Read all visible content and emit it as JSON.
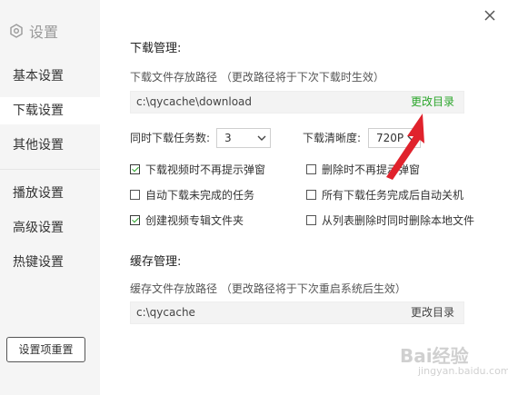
{
  "sidebar": {
    "title": "设置",
    "items": [
      {
        "label": "基本设置"
      },
      {
        "label": "下载设置"
      },
      {
        "label": "其他设置"
      },
      {
        "label": "播放设置"
      },
      {
        "label": "高级设置"
      },
      {
        "label": "热键设置"
      }
    ],
    "reset_label": "设置项重置"
  },
  "download": {
    "heading": "下载管理:",
    "path_hint": "下载文件存放路径 （更改路径将于下次下载时生效）",
    "path_value": "c:\\qycache\\download",
    "change_label": "更改目录",
    "tasks_label": "同时下载任务数:",
    "tasks_value": "3",
    "quality_label": "下载清晰度:",
    "quality_value": "720P",
    "options": [
      {
        "label": "下载视频时不再提示弹窗",
        "checked": true
      },
      {
        "label": "删除时不再提示弹窗",
        "checked": false
      },
      {
        "label": "自动下载未完成的任务",
        "checked": false
      },
      {
        "label": "所有下载任务完成后自动关机",
        "checked": false
      },
      {
        "label": "创建视频专辑文件夹",
        "checked": true
      },
      {
        "label": "从列表删除时同时删除本地文件",
        "checked": false
      }
    ]
  },
  "cache": {
    "heading": "缓存管理:",
    "path_hint": "缓存文件存放路径 （更改路径将于下次重启系统后生效）",
    "path_value": "c:\\qycache",
    "change_label": "更改目录"
  },
  "watermark": {
    "main": "Bai经验",
    "sub": "jingyan.baidu.com"
  },
  "colors": {
    "accent": "#2aa52a",
    "arrow": "#e0222c",
    "sidebar_bg": "#f5f5f5"
  }
}
